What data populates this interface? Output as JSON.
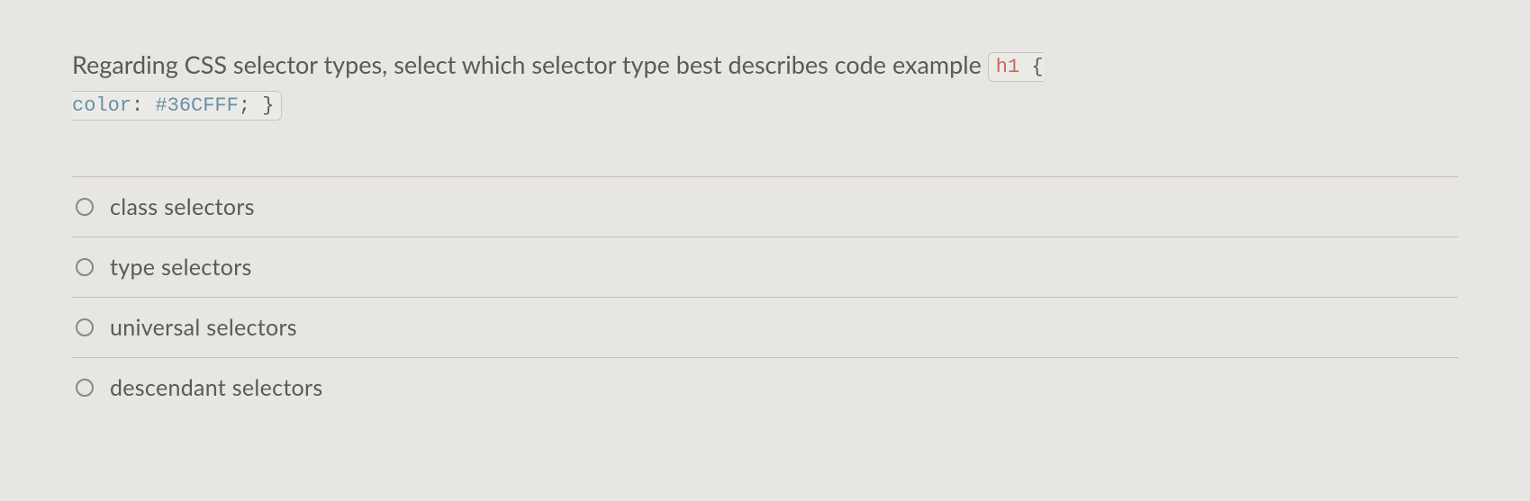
{
  "question": {
    "prompt_before_code": "Regarding CSS selector types, select which selector type best describes code example",
    "code_kw": "h1",
    "code_open_brace": " {",
    "code_prop": "color",
    "code_colon": ": ",
    "code_val": "#36CFFF",
    "code_after": "; }"
  },
  "options": [
    {
      "label": "class selectors"
    },
    {
      "label": "type selectors"
    },
    {
      "label": "universal selectors"
    },
    {
      "label": "descendant selectors"
    }
  ]
}
